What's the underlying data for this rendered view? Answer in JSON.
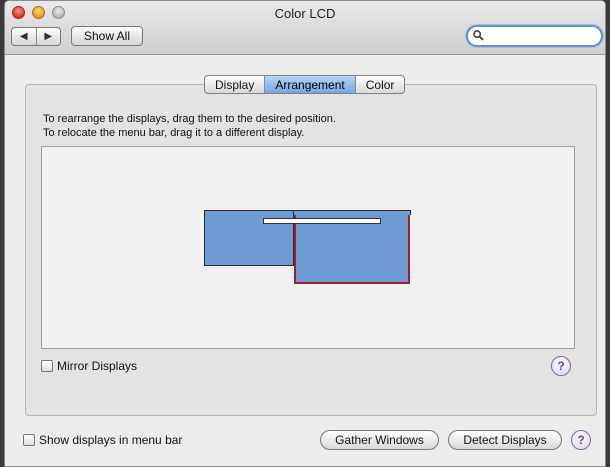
{
  "window": {
    "title": "Color LCD"
  },
  "toolbar": {
    "back_glyph": "◀",
    "forward_glyph": "▶",
    "show_all_label": "Show All",
    "search": {
      "value": "",
      "placeholder": ""
    }
  },
  "tabs": [
    {
      "label": "Display",
      "active": false
    },
    {
      "label": "Arrangement",
      "active": true
    },
    {
      "label": "Color",
      "active": false
    }
  ],
  "instructions": {
    "line1": "To rearrange the displays, drag them to the desired position.",
    "line2": "To relocate the menu bar, drag it to a different display."
  },
  "mirror": {
    "label": "Mirror Displays",
    "checked": false
  },
  "help_glyph": "?",
  "footer": {
    "show_in_menu_bar_label": "Show displays in menu bar",
    "show_in_menu_bar_checked": false,
    "gather_label": "Gather Windows",
    "detect_label": "Detect Displays"
  },
  "colors": {
    "display_fill": "#6f9bd4",
    "main_display_border": "#a21f2a",
    "active_tab": "#76a7e3"
  }
}
